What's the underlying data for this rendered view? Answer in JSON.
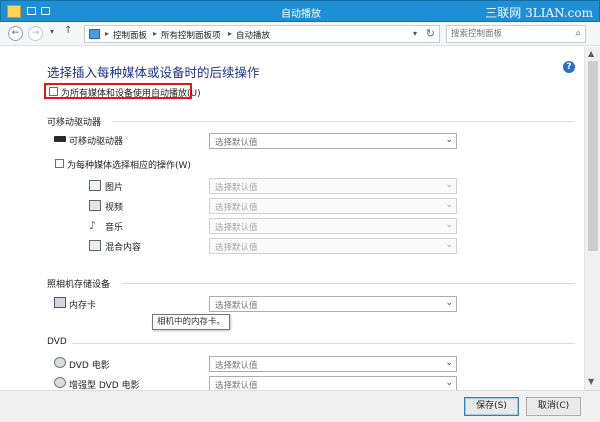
{
  "window": {
    "title": "自动播放",
    "watermark": "三联网 3LIAN.com",
    "minimize": "—",
    "maximize": "☐",
    "close": "✕"
  },
  "nav": {
    "back": "←",
    "forward": "→",
    "recent": "▾",
    "up": "↑",
    "breadcrumb": [
      "控制面板",
      "所有控制面板项",
      "自动播放"
    ],
    "breadcrumb_sep": "▸",
    "dropdown": "▾",
    "refresh": "↻",
    "search_placeholder": "搜索控制面板",
    "search_icon": "⌕"
  },
  "content": {
    "heading": "选择插入每种媒体或设备时的后续操作",
    "help": "?",
    "use_autoplay_label": "为所有媒体和设备使用自动播放(U)",
    "use_autoplay_checked": false,
    "default_choice": "选择默认值",
    "sections": {
      "removable": {
        "title": "可移动驱动器",
        "drive_label": "可移动驱动器",
        "per_media_label": "为每种媒体选择相应的操作(W)",
        "per_media_checked": false,
        "media": [
          "图片",
          "视频",
          "音乐",
          "混合内容"
        ]
      },
      "camera": {
        "title": "照相机存储设备",
        "memory_card_label": "内存卡",
        "tooltip": "相机中的内存卡。"
      },
      "dvd": {
        "title": "DVD",
        "items": [
          "DVD 电影",
          "增强型 DVD 电影"
        ]
      }
    }
  },
  "footer": {
    "save": "保存(S)",
    "cancel": "取消(C)"
  },
  "colors": {
    "titlebar": "#1e8fd4",
    "heading": "#1e3287",
    "highlight_frame": "#e01818"
  }
}
